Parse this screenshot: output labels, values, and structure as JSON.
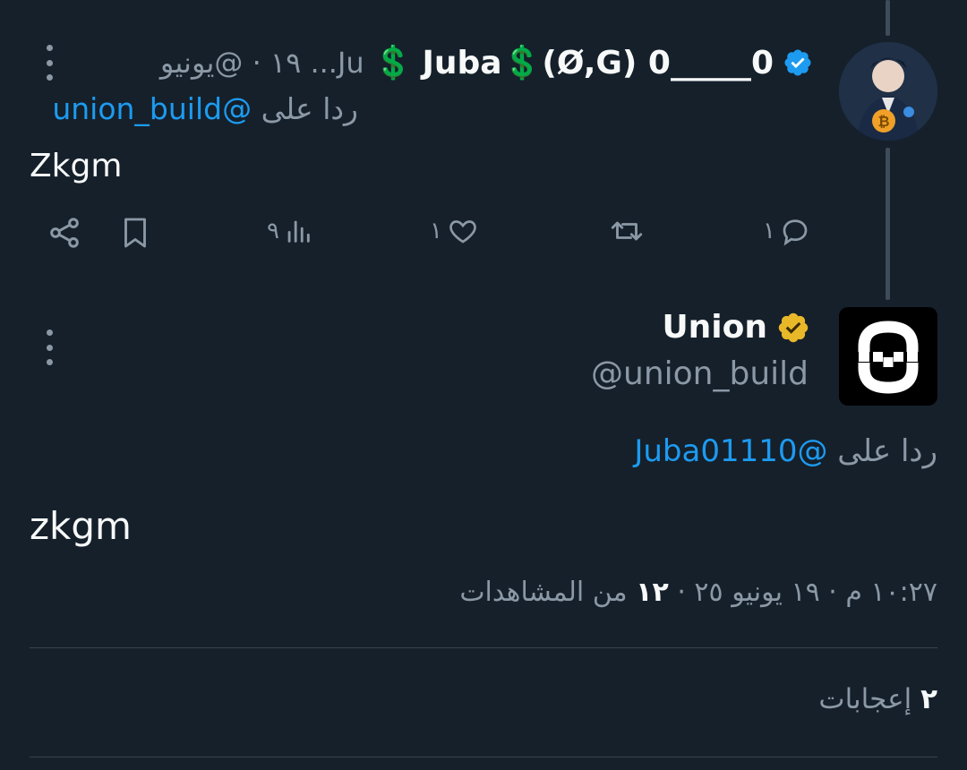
{
  "colors": {
    "background": "#15202b",
    "text_primary": "#f7f9f9",
    "text_secondary": "#8b98a5",
    "link": "#1d9bf0",
    "verified_blue": "#1d9bf0",
    "verified_gold": "#e8b829",
    "divider": "#38444d"
  },
  "reply_tweet": {
    "display_name_prefix": "💲",
    "display_name": "Juba💲(Ø,G) 0_____0",
    "verified_icon": "verified-blue-badge-icon",
    "meta": "Ju... ١٩ · @يونيو",
    "replying_to_prefix": "ردا على",
    "replying_to_handle": "@union_build",
    "text": "Zkgm",
    "actions": {
      "reply_count": "١",
      "retweet_count": "",
      "like_count": "١",
      "views_count": "٩"
    },
    "icons": [
      "reply-icon",
      "retweet-icon",
      "like-icon",
      "views-icon",
      "bookmark-icon",
      "share-icon"
    ]
  },
  "main_tweet": {
    "display_name": "Union",
    "verified_icon": "verified-gold-badge-icon",
    "handle": "@union_build",
    "replying_to_prefix": "ردا على",
    "replying_to_handle": "@Juba01110",
    "text": "zkgm",
    "timestamp": "١٠:٢٧ م · ١٩ يونيو ٢٥",
    "views_count": "١٢",
    "views_label": "من المشاهدات",
    "likes_count": "٢",
    "likes_label": "إعجابات"
  }
}
